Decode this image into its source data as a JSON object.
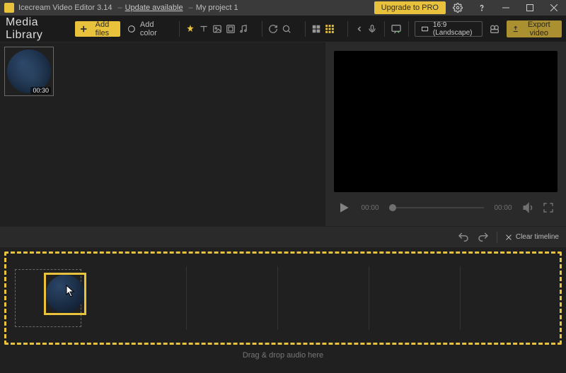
{
  "titlebar": {
    "app_name": "Icecream Video Editor 3.14",
    "update_text": "Update available",
    "project_name": "My project 1",
    "upgrade_label": "Upgrade to PRO"
  },
  "toolbar": {
    "media_library": "Media Library",
    "add_files": "Add files",
    "add_color": "Add color",
    "aspect_label": "16:9 (Landscape)",
    "export_label": "Export video"
  },
  "library": {
    "items": [
      {
        "duration": "00:30"
      }
    ]
  },
  "player": {
    "current_time": "00:00",
    "total_time": "00:00"
  },
  "actions": {
    "clear_label": "Clear timeline"
  },
  "timeline": {
    "audio_hint": "Drag & drop audio here"
  },
  "colors": {
    "accent": "#e8c23c"
  }
}
